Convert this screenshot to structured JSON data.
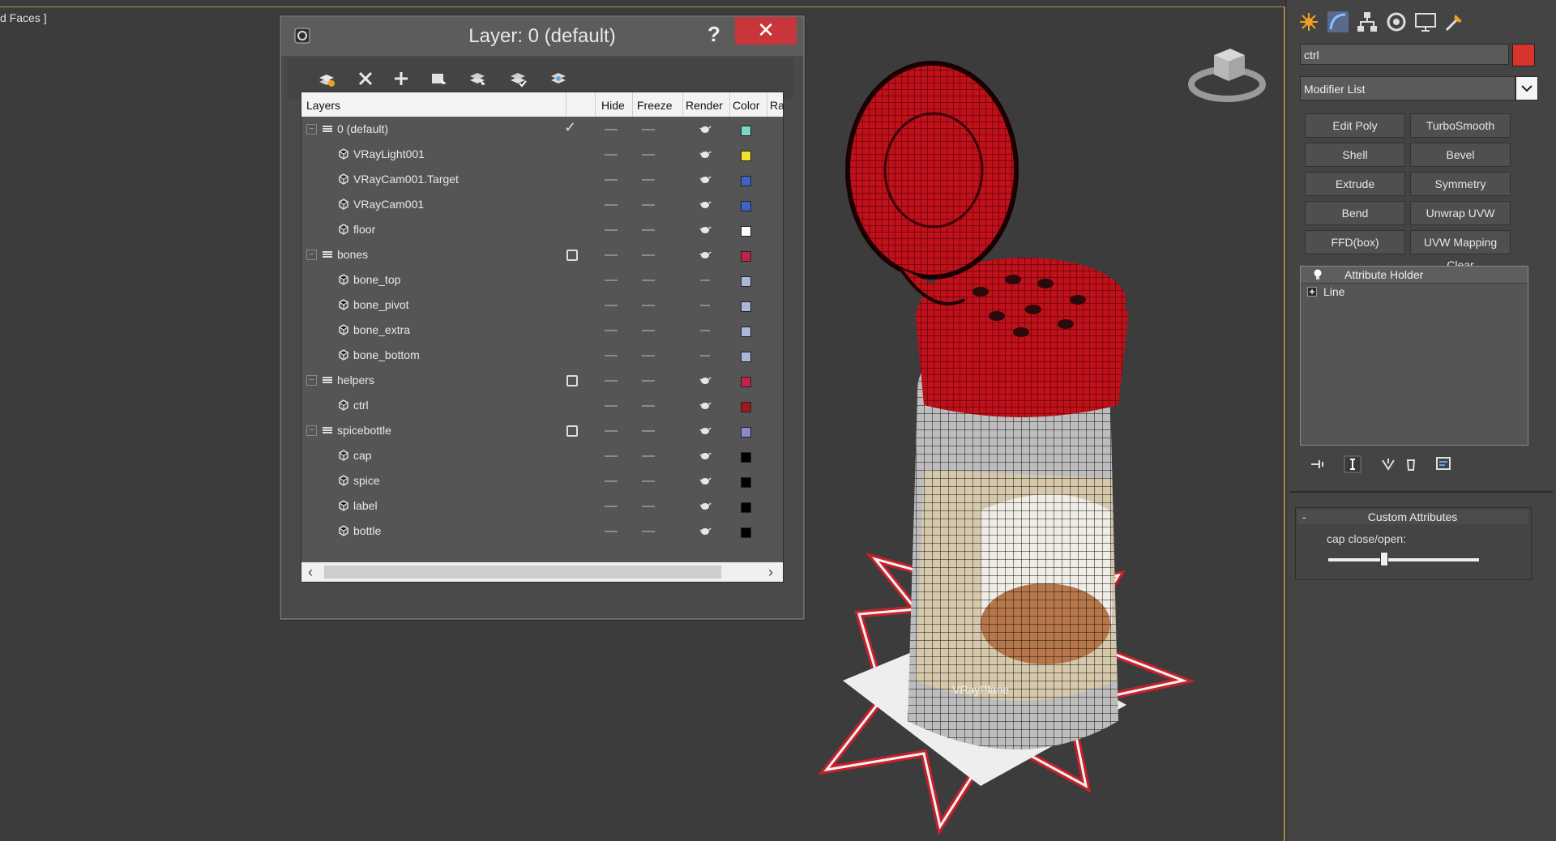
{
  "viewport": {
    "label": "d Faces ]",
    "object_label": "VRayPlane"
  },
  "layer_dialog": {
    "title": "Layer: 0 (default)",
    "help_label": "?",
    "close_label": "✕",
    "columns": [
      "Layers",
      "Hide",
      "Freeze",
      "Render",
      "Color",
      "Ra"
    ],
    "rows": [
      {
        "name": "0 (default)",
        "kind": "layer",
        "active": "check",
        "render": true,
        "color": "#79d8c8"
      },
      {
        "name": "VRayLight001",
        "kind": "object",
        "render": true,
        "color": "#f2e12a"
      },
      {
        "name": "VRayCam001.Target",
        "kind": "object",
        "render": true,
        "color": "#3e62c8"
      },
      {
        "name": "VRayCam001",
        "kind": "object",
        "render": true,
        "color": "#3e62c8"
      },
      {
        "name": "floor",
        "kind": "object",
        "render": true,
        "color": "#ffffff"
      },
      {
        "name": "bones",
        "kind": "layer",
        "active": "box",
        "render": true,
        "color": "#c1224a"
      },
      {
        "name": "bone_top",
        "kind": "object",
        "render": false,
        "color": "#aab8d8"
      },
      {
        "name": "bone_pivot",
        "kind": "object",
        "render": false,
        "color": "#aab8d8"
      },
      {
        "name": "bone_extra",
        "kind": "object",
        "render": false,
        "color": "#aab8d8"
      },
      {
        "name": "bone_bottom",
        "kind": "object",
        "render": false,
        "color": "#aab8d8"
      },
      {
        "name": "helpers",
        "kind": "layer",
        "active": "box",
        "render": true,
        "color": "#c1224a"
      },
      {
        "name": "ctrl",
        "kind": "object",
        "render": true,
        "color": "#a01818"
      },
      {
        "name": "spicebottle",
        "kind": "layer",
        "active": "box",
        "render": true,
        "color": "#8a8ad0"
      },
      {
        "name": "cap",
        "kind": "object",
        "render": true,
        "color": "#000000"
      },
      {
        "name": "spice",
        "kind": "object",
        "render": true,
        "color": "#000000"
      },
      {
        "name": "label",
        "kind": "object",
        "render": true,
        "color": "#000000"
      },
      {
        "name": "bottle",
        "kind": "object",
        "render": true,
        "color": "#000000"
      }
    ]
  },
  "command_panel": {
    "object_name": "ctrl",
    "object_color": "#d9342b",
    "modifier_list": "Modifier List",
    "modifier_buttons": [
      "Edit Poly",
      "TurboSmooth",
      "Shell",
      "Bevel",
      "Extrude",
      "Symmetry",
      "Bend",
      "Unwrap UVW",
      "FFD(box)",
      "UVW Mapping Clear"
    ],
    "stack": [
      {
        "label": "Attribute Holder",
        "icon": "lightbulb-icon"
      },
      {
        "label": "Line",
        "icon": "plus-box-icon"
      }
    ],
    "rollout": {
      "toggle": "-",
      "title": "Custom Attributes",
      "slider_label": "cap close/open:",
      "slider_value": 0.37
    }
  }
}
